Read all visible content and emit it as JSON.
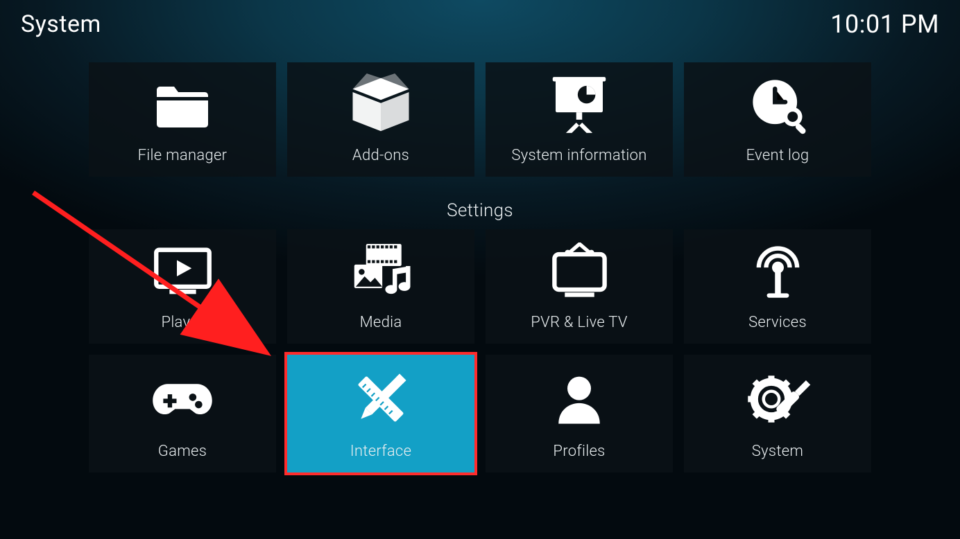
{
  "header": {
    "title": "System",
    "clock": "10:01 PM"
  },
  "top_tiles": [
    {
      "name": "file-manager",
      "label": "File manager",
      "icon": "folder-icon"
    },
    {
      "name": "add-ons",
      "label": "Add-ons",
      "icon": "box-icon"
    },
    {
      "name": "system-info",
      "label": "System information",
      "icon": "presentation-icon"
    },
    {
      "name": "event-log",
      "label": "Event log",
      "icon": "clock-search-icon"
    }
  ],
  "section_label": "Settings",
  "settings_tiles": [
    {
      "name": "player",
      "label": "Player",
      "icon": "play-screen-icon"
    },
    {
      "name": "media",
      "label": "Media",
      "icon": "media-stack-icon"
    },
    {
      "name": "pvr",
      "label": "PVR & Live TV",
      "icon": "tv-icon"
    },
    {
      "name": "services",
      "label": "Services",
      "icon": "broadcast-icon"
    },
    {
      "name": "games",
      "label": "Games",
      "icon": "gamepad-icon"
    },
    {
      "name": "interface",
      "label": "Interface",
      "icon": "pencil-ruler-icon",
      "selected": true
    },
    {
      "name": "profiles",
      "label": "Profiles",
      "icon": "user-icon"
    },
    {
      "name": "system",
      "label": "System",
      "icon": "gear-tools-icon"
    }
  ],
  "annotation": {
    "arrow_target": "interface"
  }
}
